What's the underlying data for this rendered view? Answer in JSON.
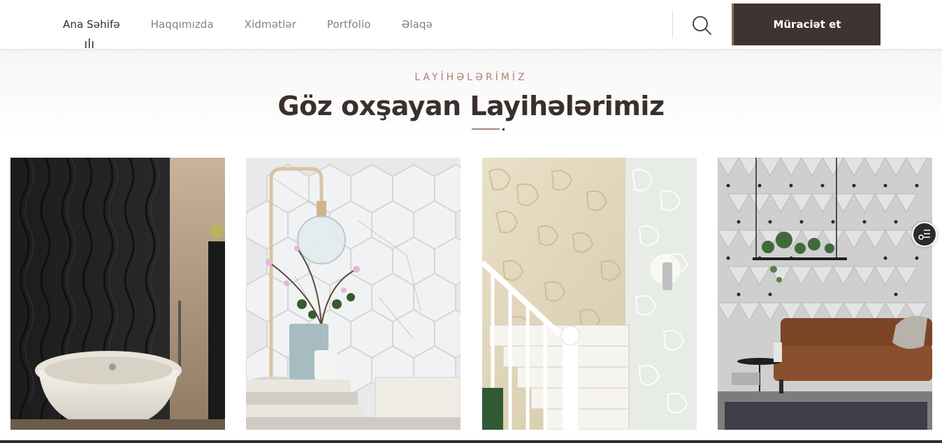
{
  "header": {
    "nav": [
      {
        "label": "Ana Səhifə",
        "active": true
      },
      {
        "label": "Haqqımızda",
        "active": false
      },
      {
        "label": "Xidmətlər",
        "active": false
      },
      {
        "label": "Portfolio",
        "active": false
      },
      {
        "label": "Əlaqə",
        "active": false
      }
    ],
    "search_icon": "search-icon",
    "cta_label": "Müraciət et"
  },
  "section": {
    "eyebrow": "LAYİHƏLƏRİMİZ",
    "title": "Göz oxşayan Layihələrimiz"
  },
  "projects": [
    {
      "image": "black-wave-wall-bathroom"
    },
    {
      "image": "marble-hexagon-tiles-lamp"
    },
    {
      "image": "cream-stone-wall-staircase"
    },
    {
      "image": "white-3d-triangle-panel-living-room"
    }
  ],
  "floating_button_icon": "list-settings-icon",
  "colors": {
    "brand_dark": "#3e3432",
    "accent": "#a88377",
    "title": "#3b2f2c",
    "nav_text": "#8a7d78"
  }
}
